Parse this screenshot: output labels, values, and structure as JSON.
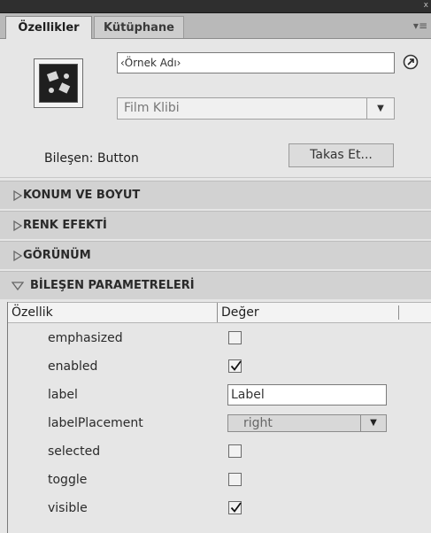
{
  "panel": {
    "tabs": [
      {
        "label": "Özellikler"
      },
      {
        "label": "Kütüphane"
      }
    ]
  },
  "instance": {
    "name_placeholder": "‹Örnek Adı›",
    "type_value": "Film Klibi"
  },
  "component": {
    "label": "Bileşen: Button",
    "swap_label": "Takas Et..."
  },
  "sections": [
    {
      "title": "KONUM VE BOYUT",
      "expanded": false
    },
    {
      "title": "RENK EFEKTİ",
      "expanded": false
    },
    {
      "title": "GÖRÜNÜM",
      "expanded": false
    },
    {
      "title": "BİLEŞEN PARAMETRELERİ",
      "expanded": true
    }
  ],
  "params": {
    "col_property": "Özellik",
    "col_value": "Değer",
    "rows": [
      {
        "name": "emphasized",
        "type": "checkbox",
        "checked": false
      },
      {
        "name": "enabled",
        "type": "checkbox",
        "checked": true
      },
      {
        "name": "label",
        "type": "text",
        "value": "Label"
      },
      {
        "name": "labelPlacement",
        "type": "select",
        "value": "right"
      },
      {
        "name": "selected",
        "type": "checkbox",
        "checked": false
      },
      {
        "name": "toggle",
        "type": "checkbox",
        "checked": false
      },
      {
        "name": "visible",
        "type": "checkbox",
        "checked": true
      }
    ]
  }
}
